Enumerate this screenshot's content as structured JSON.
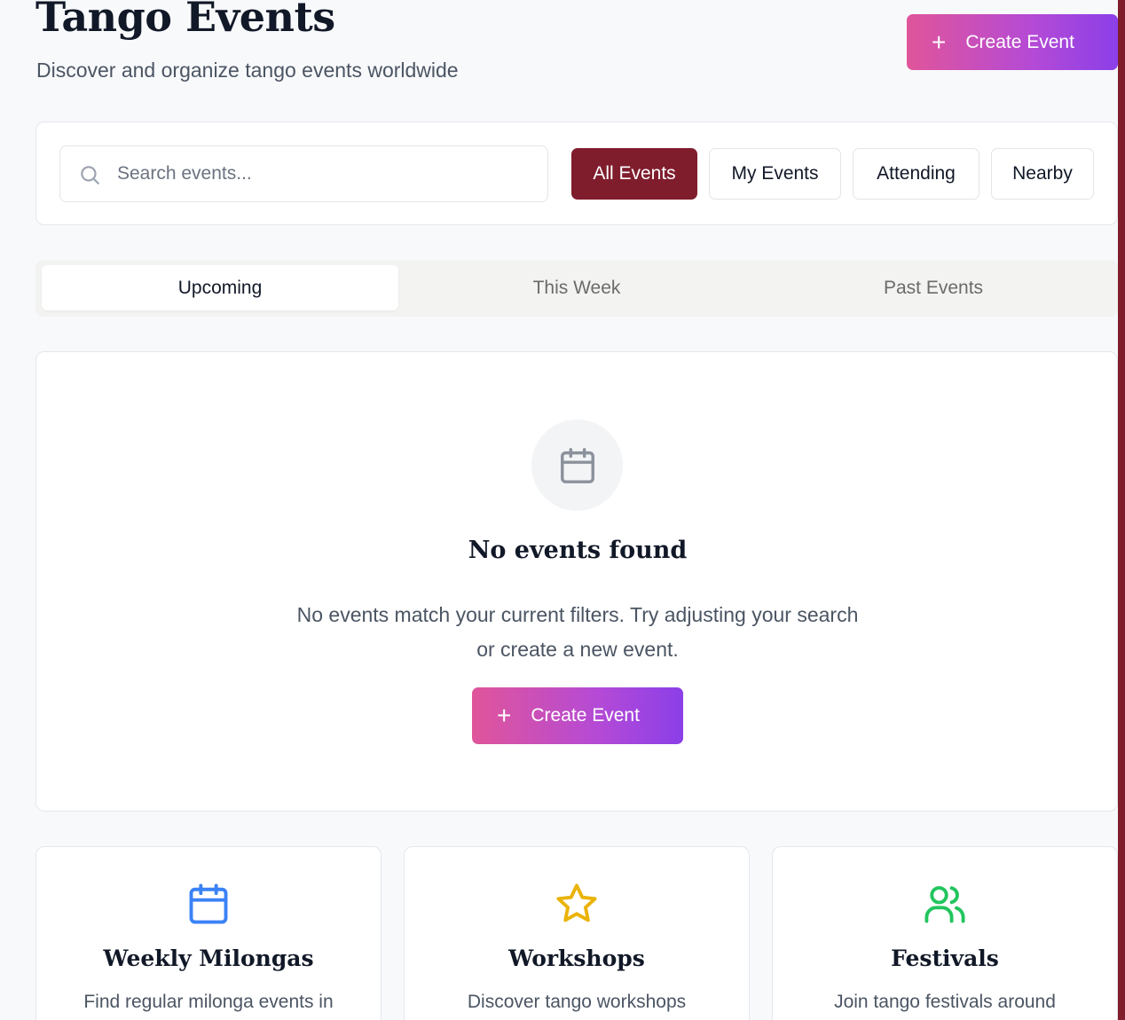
{
  "header": {
    "title": "Tango Events",
    "subtitle": "Discover and organize tango events worldwide",
    "create_button_label": "Create Event",
    "plus_glyph": "+"
  },
  "filters": {
    "search_placeholder": "Search events...",
    "search_value": "",
    "chips": [
      {
        "label": "All Events",
        "active": true
      },
      {
        "label": "My Events",
        "active": false
      },
      {
        "label": "Attending",
        "active": false
      },
      {
        "label": "Nearby",
        "active": false
      }
    ]
  },
  "tabs": [
    {
      "label": "Upcoming",
      "active": true
    },
    {
      "label": "This Week",
      "active": false
    },
    {
      "label": "Past Events",
      "active": false
    }
  ],
  "empty_state": {
    "icon": "calendar-icon",
    "title": "No events found",
    "description": "No events match your current filters. Try adjusting your search or create a new event.",
    "create_button_label": "Create Event"
  },
  "features": [
    {
      "icon": "calendar-icon",
      "icon_color": "#3b82f6",
      "title": "Weekly Milongas",
      "description": "Find regular milonga events in"
    },
    {
      "icon": "star-icon",
      "icon_color": "#eab308",
      "title": "Workshops",
      "description": "Discover tango workshops"
    },
    {
      "icon": "users-icon",
      "icon_color": "#22c55e",
      "title": "Festivals",
      "description": "Join tango festivals around"
    }
  ],
  "colors": {
    "accent": "#7f1d2d",
    "gradient_start": "#e0559a",
    "gradient_end": "#8b3fe8"
  }
}
